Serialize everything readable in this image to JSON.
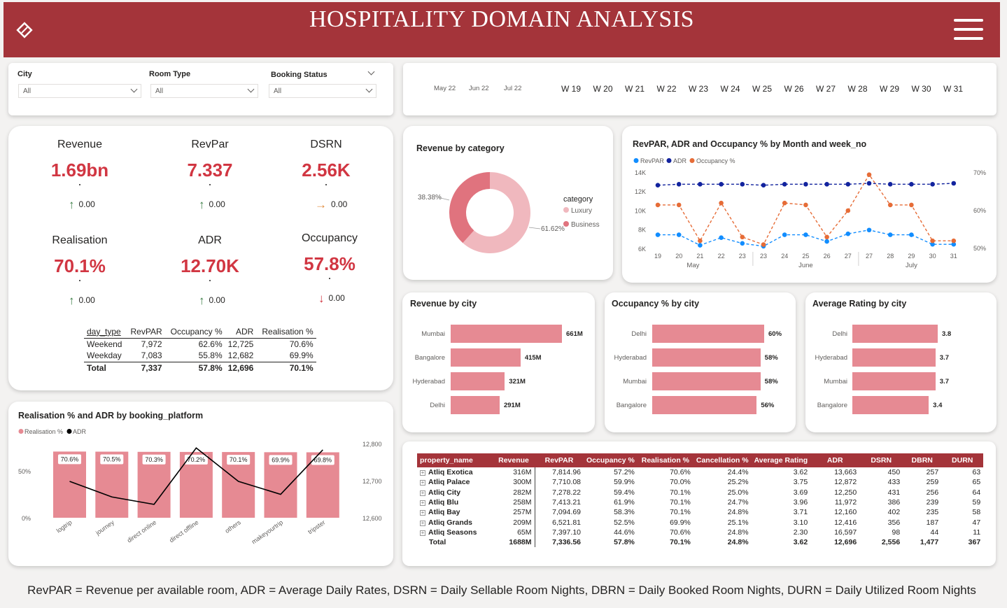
{
  "header": {
    "title": "HOSPITALITY DOMAIN ANALYSIS",
    "logo_icon": "diamond-tag-icon",
    "menu_icon": "hamburger-menu-icon"
  },
  "filters": [
    {
      "label": "City",
      "value": "All"
    },
    {
      "label": "Room Type",
      "value": "All"
    },
    {
      "label": "Booking Status",
      "value": "All"
    }
  ],
  "timeline": {
    "months": [
      "May 22",
      "Jun 22",
      "Jul 22"
    ],
    "weeks": [
      "W 19",
      "W 20",
      "W 21",
      "W 22",
      "W 23",
      "W 24",
      "W 25",
      "W 26",
      "W 27",
      "W 28",
      "W 29",
      "W 30",
      "W 31"
    ]
  },
  "kpis": [
    {
      "label": "Revenue",
      "value": "1.69bn",
      "delta": "0.00",
      "trend": "up",
      "color": "#3a7d44"
    },
    {
      "label": "RevPar",
      "value": "7.337",
      "delta": "0.00",
      "trend": "up",
      "color": "#3a7d44"
    },
    {
      "label": "DSRN",
      "value": "2.56K",
      "delta": "0.00",
      "trend": "right",
      "color": "#e0893a"
    },
    {
      "label": "Realisation",
      "value": "70.1%",
      "delta": "0.00",
      "trend": "up",
      "color": "#3a7d44"
    },
    {
      "label": "ADR",
      "value": "12.70K",
      "delta": "0.00",
      "trend": "up",
      "color": "#3a7d44"
    },
    {
      "label": "Occupancy",
      "value": "57.8%",
      "delta": "0.00",
      "trend": "down",
      "color": "#d13642"
    }
  ],
  "daytype_table": {
    "headers": [
      "day_type",
      "RevPAR",
      "Occupancy %",
      "ADR",
      "Realisation %"
    ],
    "rows": [
      [
        "Weekend",
        "7,972",
        "62.6%",
        "12,725",
        "70.6%"
      ],
      [
        "Weekday",
        "7,083",
        "55.8%",
        "12,682",
        "69.9%"
      ]
    ],
    "total": [
      "Total",
      "7,337",
      "57.8%",
      "12,696",
      "70.1%"
    ]
  },
  "revenue_by_category": {
    "title": "Revenue by category",
    "legend_title": "category",
    "labels": [
      "38.38%",
      "61.62%"
    ],
    "chart_data": {
      "type": "pie",
      "categories": [
        "Luxury",
        "Business"
      ],
      "values": [
        61.62,
        38.38
      ],
      "colors": [
        "#f0b8be",
        "#e0737e"
      ]
    }
  },
  "weekly_chart": {
    "title": "RevPAR, ADR and Occupancy % by Month and week_no",
    "left_ticks": [
      "14K",
      "12K",
      "10K",
      "8K",
      "6K"
    ],
    "right_ticks": [
      "70%",
      "60%",
      "50%"
    ],
    "month_labels": [
      "May",
      "June",
      "July"
    ],
    "chart_data": {
      "type": "line",
      "x": [
        "19",
        "20",
        "21",
        "22",
        "23",
        "23",
        "24",
        "25",
        "26",
        "27",
        "27",
        "28",
        "29",
        "30",
        "31"
      ],
      "ylim_left": [
        6000,
        14000
      ],
      "ylim_right": [
        50,
        70
      ],
      "series": [
        {
          "name": "RevPAR",
          "axis": "left",
          "color": "#118dff",
          "values": [
            7500,
            7500,
            6400,
            7200,
            6600,
            6300,
            7500,
            7500,
            6800,
            7600,
            8000,
            7500,
            7500,
            6500,
            6500
          ]
        },
        {
          "name": "ADR",
          "axis": "left",
          "color": "#12239e",
          "values": [
            12700,
            12800,
            12800,
            12800,
            12800,
            12700,
            12800,
            12800,
            12800,
            12800,
            12900,
            12800,
            12800,
            12800,
            12900
          ]
        },
        {
          "name": "Occupancy %",
          "axis": "right",
          "color": "#e66c37",
          "values": [
            61.5,
            61.5,
            52,
            62,
            53,
            51,
            62,
            61.5,
            53,
            60,
            69.5,
            61.5,
            61.5,
            52,
            52
          ]
        }
      ]
    }
  },
  "revenue_by_city": {
    "title": "Revenue by city",
    "chart_data": {
      "type": "bar",
      "categories": [
        "Mumbai",
        "Bangalore",
        "Hyderabad",
        "Delhi"
      ],
      "values": [
        661,
        415,
        321,
        291
      ],
      "labels": [
        "661M",
        "415M",
        "321M",
        "291M"
      ],
      "xlim": [
        0,
        661
      ]
    }
  },
  "occupancy_by_city": {
    "title": "Occupancy % by city",
    "chart_data": {
      "type": "bar",
      "categories": [
        "Delhi",
        "Hyderabad",
        "Mumbai",
        "Bangalore"
      ],
      "values": [
        60,
        58,
        58,
        56
      ],
      "labels": [
        "60%",
        "58%",
        "58%",
        "56%"
      ],
      "xlim": [
        0,
        60
      ]
    }
  },
  "rating_by_city": {
    "title": "Average Rating by city",
    "chart_data": {
      "type": "bar",
      "categories": [
        "Delhi",
        "Hyderabad",
        "Mumbai",
        "Bangalore"
      ],
      "values": [
        3.8,
        3.7,
        3.7,
        3.4
      ],
      "labels": [
        "3.8",
        "3.7",
        "3.7",
        "3.4"
      ],
      "xlim": [
        0,
        3.8
      ]
    }
  },
  "platform_chart": {
    "title": "Realisation % and ADR by booking_platform",
    "legend": [
      "Realisation %",
      "ADR"
    ],
    "left_ticks": [
      "50%",
      "0%"
    ],
    "right_ticks": [
      "12,800",
      "12,700",
      "12,600"
    ],
    "chart_data": {
      "type": "bar",
      "categories": [
        "logtrip",
        "journey",
        "direct online",
        "direct offline",
        "others",
        "makeyourtrip",
        "tripster"
      ],
      "series": [
        {
          "name": "Realisation %",
          "color": "#e68a93",
          "values": [
            70.6,
            70.5,
            70.3,
            70.2,
            70.1,
            69.9,
            69.8
          ],
          "labels": [
            "70.6%",
            "70.5%",
            "70.3%",
            "70.2%",
            "70.1%",
            "69.9%",
            "69.8%"
          ]
        },
        {
          "name": "ADR",
          "color": "#000000",
          "values": [
            12700,
            12658,
            12638,
            12790,
            12700,
            12665,
            12785
          ]
        }
      ],
      "ylim_left": [
        0,
        80
      ],
      "ylim_right": [
        12600,
        12800
      ]
    }
  },
  "property_table": {
    "headers": [
      "property_name",
      "Revenue",
      "RevPAR",
      "Occupancy %",
      "Realisation %",
      "Cancellation %",
      "Average Rating",
      "ADR",
      "DSRN",
      "DBRN",
      "DURN"
    ],
    "rows": [
      [
        "Atliq Exotica",
        "316M",
        "7,814.96",
        "57.2%",
        "70.6%",
        "24.4%",
        "3.62",
        "13,663",
        "450",
        "257",
        "63"
      ],
      [
        "Atliq Palace",
        "300M",
        "7,710.08",
        "59.9%",
        "70.0%",
        "25.2%",
        "3.75",
        "12,872",
        "433",
        "259",
        "65"
      ],
      [
        "Atliq City",
        "282M",
        "7,278.22",
        "59.4%",
        "70.1%",
        "25.0%",
        "3.69",
        "12,250",
        "431",
        "256",
        "64"
      ],
      [
        "Atliq Blu",
        "258M",
        "7,413.21",
        "61.9%",
        "70.1%",
        "24.7%",
        "3.96",
        "11,972",
        "386",
        "239",
        "59"
      ],
      [
        "Atliq Bay",
        "257M",
        "7,094.69",
        "58.3%",
        "70.1%",
        "24.8%",
        "3.71",
        "12,160",
        "402",
        "235",
        "58"
      ],
      [
        "Atliq Grands",
        "209M",
        "6,521.81",
        "52.5%",
        "69.9%",
        "25.1%",
        "3.10",
        "12,416",
        "356",
        "187",
        "47"
      ],
      [
        "Atliq Seasons",
        "65M",
        "7,397.10",
        "44.6%",
        "70.6%",
        "24.8%",
        "2.30",
        "16,597",
        "98",
        "44",
        "11"
      ]
    ],
    "total": [
      "Total",
      "1688M",
      "7,336.56",
      "57.8%",
      "70.1%",
      "24.8%",
      "3.62",
      "12,696",
      "2,556",
      "1,477",
      "367"
    ]
  },
  "footer": "RevPAR = Revenue per available room, ADR = Average Daily Rates, DSRN = Daily Sellable Room Nights, DBRN = Daily Booked Room Nights, DURN = Daily Utilized Room Nights"
}
